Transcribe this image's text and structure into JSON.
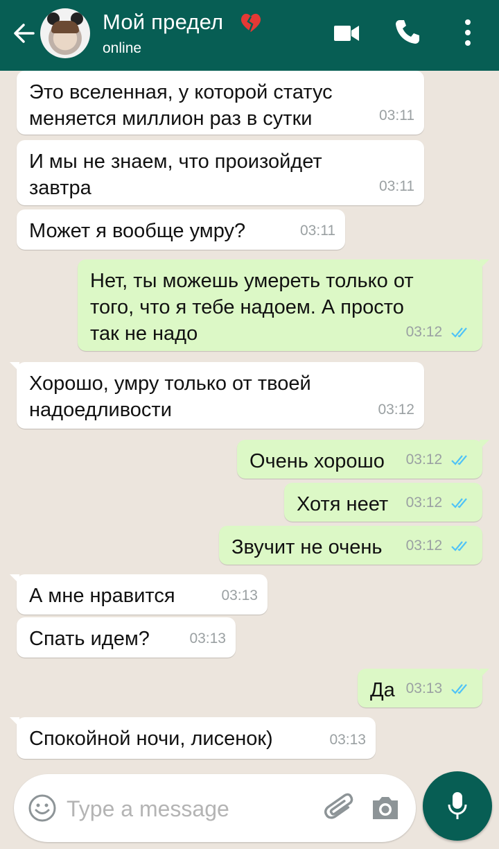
{
  "header": {
    "contact_name": "Мой предел",
    "status": "online",
    "accent_color": "#075e54",
    "icons": [
      "back-arrow-icon",
      "avatar",
      "broken-heart-icon",
      "video-call-icon",
      "phone-icon",
      "more-vert-icon"
    ]
  },
  "messages": [
    {
      "dir": "in",
      "text": "Это вселенная, у которой статус\nменяется миллион раз в сутки",
      "time": "03:11"
    },
    {
      "dir": "in",
      "text": "И мы не знаем, что произойдет\nзавтра",
      "time": "03:11"
    },
    {
      "dir": "in",
      "text": "Может я вообще умру?",
      "time": "03:11"
    },
    {
      "dir": "out",
      "text": "Нет, ты можешь умереть только от\nтого, что я тебе надоем. А просто\nтак не надо",
      "time": "03:12",
      "read": true
    },
    {
      "dir": "in",
      "text": "Хорошо, умру только от твоей\nнадоедливости",
      "time": "03:12"
    },
    {
      "dir": "out",
      "text": "Очень хорошо",
      "time": "03:12",
      "read": true
    },
    {
      "dir": "out",
      "text": "Хотя неет",
      "time": "03:12",
      "read": true
    },
    {
      "dir": "out",
      "text": "Звучит не очень",
      "time": "03:12",
      "read": true
    },
    {
      "dir": "in",
      "text": "А мне нравится",
      "time": "03:13"
    },
    {
      "dir": "in",
      "text": "Спать идем?",
      "time": "03:13"
    },
    {
      "dir": "out",
      "text": "Да",
      "time": "03:13",
      "read": true
    },
    {
      "dir": "in",
      "text": "Спокойной ночи, лисенок)",
      "time": "03:13"
    }
  ],
  "composer": {
    "placeholder": "Type a message",
    "value": ""
  },
  "colors": {
    "chat_bg": "#ece5dd",
    "incoming_bubble": "#ffffff",
    "outgoing_bubble": "#dcf8c6",
    "read_ticks": "#4fc3f7"
  }
}
